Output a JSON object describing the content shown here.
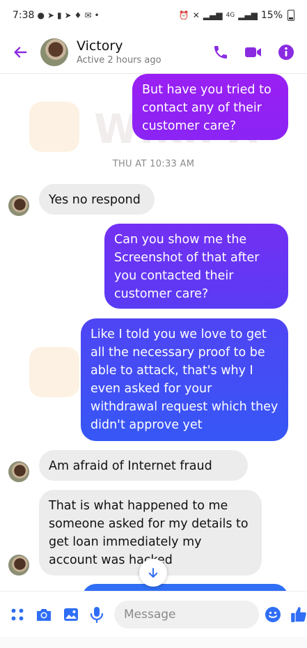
{
  "status_bar": {
    "time": "7:38",
    "network": "4G",
    "battery": "15%"
  },
  "header": {
    "contact_name": "Victory",
    "contact_status": "Active 2 hours ago"
  },
  "chat": {
    "messages": [
      {
        "direction": "outgoing",
        "text": "But have you tried to contact any of their customer care?"
      },
      {
        "type": "timestamp",
        "text": "THU AT 10:33 AM"
      },
      {
        "direction": "incoming",
        "text": "Yes no respond"
      },
      {
        "direction": "outgoing",
        "text": "Can you show me the Screenshot of that after you contacted their customer care?"
      },
      {
        "direction": "outgoing",
        "text": "Like I told you we love to get all the necessary proof to be able to attack, that's why I even asked for your withdrawal request which they didn't approve yet"
      },
      {
        "direction": "incoming",
        "text": "Am afraid of Internet fraud"
      },
      {
        "direction": "incoming",
        "text": "That is what happened to me someone asked for my details to get loan immediately my account was hacked"
      }
    ],
    "watermark": "WikiFX"
  },
  "composer": {
    "placeholder": "Message"
  },
  "colors": {
    "accent": "#7b2ff7",
    "bubble_top": "#a21bf2",
    "bubble_bottom": "#2f6ef5",
    "incoming_bubble": "#ececec"
  },
  "icons": {
    "back": "back-arrow-icon",
    "call": "phone-icon",
    "video": "video-camera-icon",
    "info": "info-icon",
    "apps": "apps-grid-icon",
    "camera": "camera-icon",
    "gallery": "gallery-icon",
    "mic": "microphone-icon",
    "emoji": "emoji-icon",
    "like": "thumbs-up-icon",
    "scroll": "arrow-down-icon"
  }
}
